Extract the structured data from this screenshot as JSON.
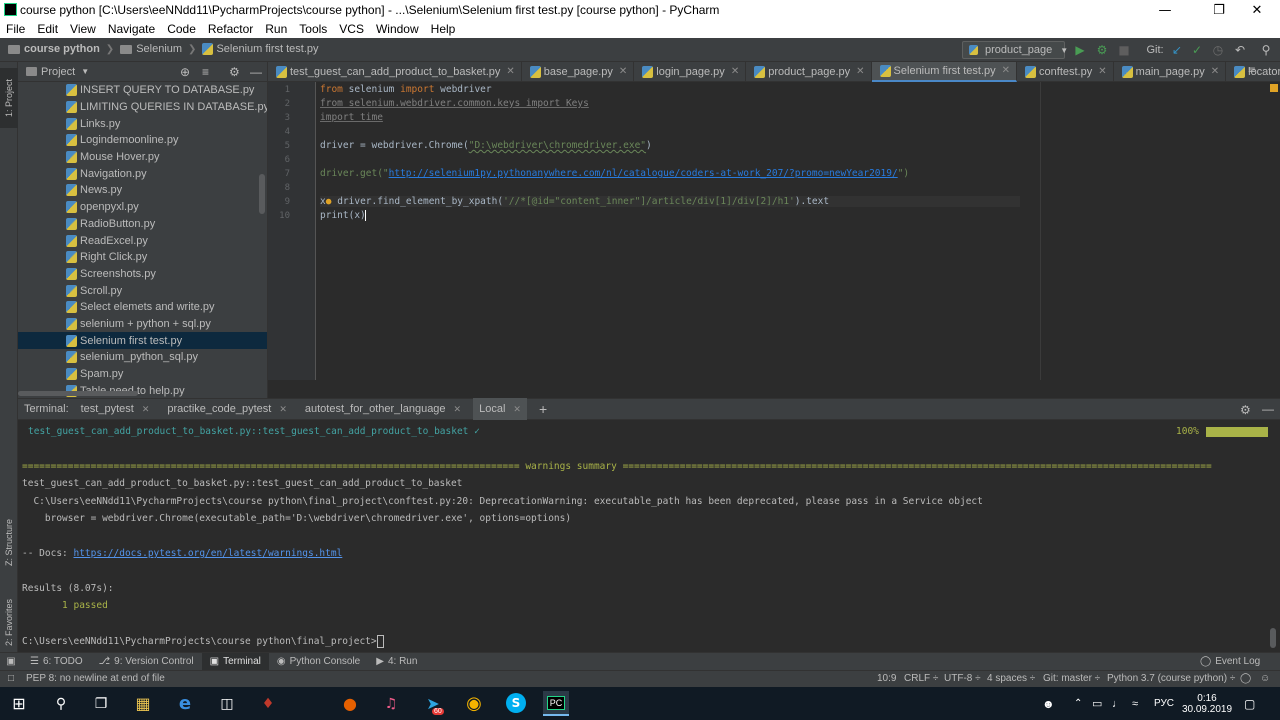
{
  "window": {
    "title": "course python [C:\\Users\\eeNNdd11\\PycharmProjects\\course python] - ...\\Selenium\\Selenium first test.py [course python] - PyCharm"
  },
  "menu": [
    "File",
    "Edit",
    "View",
    "Navigate",
    "Code",
    "Refactor",
    "Run",
    "Tools",
    "VCS",
    "Window",
    "Help"
  ],
  "breadcrumb": {
    "project": "course python",
    "folder": "Selenium",
    "file": "Selenium first test.py"
  },
  "run_config": {
    "label": "product_page"
  },
  "git_label": "Git:",
  "left_strip": {
    "project": "1: Project",
    "structure": "Z: Structure",
    "favorites": "2: Favorites"
  },
  "project_panel": {
    "title": "Project",
    "items": [
      "INSERT QUERY TO DATABASE.py",
      "LIMITING QUERIES IN DATABASE.py",
      "Links.py",
      "Logindemoonline.py",
      "Mouse Hover.py",
      "Navigation.py",
      "News.py",
      "openpyxl.py",
      "RadioButton.py",
      "ReadExcel.py",
      "Right Click.py",
      "Screenshots.py",
      "Scroll.py",
      "Select elemets and write.py",
      "selenium + python + sql.py",
      "Selenium first test.py",
      "selenium_python_sql.py",
      "Spam.py",
      "Table need to help.py"
    ],
    "selected_index": 15
  },
  "tabs": [
    {
      "label": "test_guest_can_add_product_to_basket.py",
      "active": false
    },
    {
      "label": "base_page.py",
      "active": false
    },
    {
      "label": "login_page.py",
      "active": false
    },
    {
      "label": "product_page.py",
      "active": false
    },
    {
      "label": "Selenium first test.py",
      "active": true
    },
    {
      "label": "conftest.py",
      "active": false
    },
    {
      "label": "main_page.py",
      "active": false
    },
    {
      "label": "locators.py",
      "active": false
    }
  ],
  "code": {
    "line_numbers": [
      "1",
      "2",
      "3",
      "4",
      "5",
      "6",
      "7",
      "8",
      "9",
      "10"
    ],
    "l1_from": "from",
    "l1_mid": " selenium ",
    "l1_import": "import",
    "l1_end": " webdriver",
    "l2": "from selenium.webdriver.common.keys import Keys",
    "l3": "import time",
    "l5_a": "driver = webdriver.Chrome(",
    "l5_str": "\"D:\\webdriver\\chromedriver.exe\"",
    "l5_b": ")",
    "l7_a": "driver.get(\"",
    "l7_url": "http://selenium1py.pythonanywhere.com/nl/catalogue/coders-at-work_207/?promo=newYear2019/",
    "l7_b": "\")",
    "l9_a": "x",
    "l9_b": " driver.find_element_by_xpath(",
    "l9_str": "'//*[@id=\"content_inner\"]/article/div[1]/div[2]/h1'",
    "l9_c": ").text",
    "l10": "print(x)"
  },
  "terminal_tabs": {
    "label": "Terminal:",
    "tabs": [
      "test_pytest",
      "practike_code_pytest",
      "autotest_for_other_language",
      "Local"
    ],
    "active_index": 3
  },
  "terminal": {
    "test_line": "test_guest_can_add_product_to_basket.py::test_guest_can_add_product_to_basket ✓",
    "percent": "100%",
    "summary_left": "=======================================================================================",
    "summary_title": " warnings summary ",
    "summary_right": "=======================================================================================================",
    "w1": "test_guest_can_add_product_to_basket.py::test_guest_can_add_product_to_basket",
    "w2": "  C:\\Users\\eeNNdd11\\PycharmProjects\\course python\\final_project\\conftest.py:20: DeprecationWarning: executable_path has been deprecated, please pass in a Service object",
    "w3": "    browser = webdriver.Chrome(executable_path='D:\\webdriver\\chromedriver.exe', options=options)",
    "docs_label": "-- Docs: ",
    "docs_url": "https://docs.pytest.org/en/latest/warnings.html",
    "results": "Results (8.07s):",
    "passed": "       1 passed",
    "prompt": "C:\\Users\\eeNNdd11\\PycharmProjects\\course python\\final_project>"
  },
  "bottom_tabs": [
    "6: TODO",
    "9: Version Control",
    "Terminal",
    "Python Console",
    "4: Run"
  ],
  "bottom_active": 2,
  "event_log": "Event Log",
  "status": {
    "message": "PEP 8: no newline at end of file",
    "pos": "10:9",
    "crlf": "CRLF ÷",
    "enc": "UTF-8 ÷",
    "indent": "4 spaces ÷",
    "git": "Git: master ÷",
    "interp": "Python 3.7 (course python) ÷"
  },
  "taskbar": {
    "lang": "РУС",
    "time": "0:16",
    "date": "30.09.2019",
    "badge": "60"
  }
}
